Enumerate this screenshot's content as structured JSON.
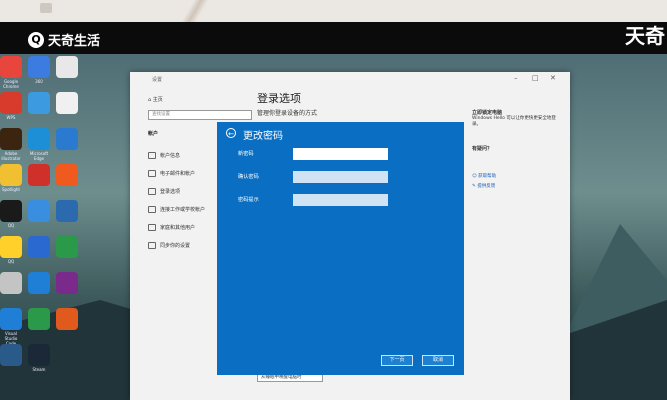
{
  "overlay": {
    "brand_text": "天奇生活",
    "brand_glyph": "Q",
    "brand_right_text": "天奇"
  },
  "desktop_icons": [
    {
      "label": "Google Chrome",
      "color": "#e8453c"
    },
    {
      "label": "360",
      "color": "#3c7be0"
    },
    {
      "label": "",
      "color": "#e8e8e8"
    },
    {
      "label": "WPS",
      "color": "#d83b2b"
    },
    {
      "label": "",
      "color": "#3c9be0"
    },
    {
      "label": "",
      "color": "#f0f0f0"
    },
    {
      "label": "Adobe Illustrator",
      "color": "#3b2410"
    },
    {
      "label": "Microsoft Edge",
      "color": "#1d8fd6"
    },
    {
      "label": "",
      "color": "#2a7ad0"
    },
    {
      "label": "Spotlight",
      "color": "#f0c030"
    },
    {
      "label": "",
      "color": "#d0302a"
    },
    {
      "label": "",
      "color": "#f05a1e"
    },
    {
      "label": "QQ",
      "color": "#1a1a1a"
    },
    {
      "label": "",
      "color": "#3a8ee0"
    },
    {
      "label": "",
      "color": "#2c6ab0"
    },
    {
      "label": "QQ",
      "color": "#ffd02a"
    },
    {
      "label": "",
      "color": "#2a6ad0"
    },
    {
      "label": "",
      "color": "#2a9a4a"
    },
    {
      "label": "",
      "color": "#c4c4c4"
    },
    {
      "label": "",
      "color": "#1f7fd6"
    },
    {
      "label": "",
      "color": "#7a2a8a"
    },
    {
      "label": "Visual Studio Code",
      "color": "#1f7fd6"
    },
    {
      "label": "",
      "color": "#2a9a4a"
    },
    {
      "label": "",
      "color": "#e05a1e"
    },
    {
      "label": "",
      "color": "#2a5a8a"
    },
    {
      "label": "Steam",
      "color": "#1b2838"
    }
  ],
  "settings": {
    "window_title": "设置",
    "home_label": "主页",
    "search_placeholder": "查找设置",
    "category": "帐户",
    "nav_items": [
      "帐户信息",
      "电子邮件和帐户",
      "登录选项",
      "连接工作或学校帐户",
      "家庭和其他用户",
      "同步你的设置"
    ],
    "page_title": "登录选项",
    "page_subtitle": "管理你登录设备的方式",
    "right_heading": "立即锁定电脑",
    "right_text": "Windows Hello 可以让你更快更安全地登录。",
    "right_heading2": "有疑问？",
    "right_link1": "获取帮助",
    "right_link2": "提供反馈",
    "bottom_dropdown": "从睡眠中唤醒电脑时"
  },
  "dialog": {
    "title": "更改密码",
    "fields": [
      {
        "label": "新密码",
        "value": ""
      },
      {
        "label": "确认密码",
        "value": ""
      },
      {
        "label": "密码提示",
        "value": ""
      }
    ],
    "next_button": "下一页",
    "cancel_button": "取消"
  },
  "colors": {
    "dialog_blue": "#0a6fc3",
    "button_blue": "#1e80d0",
    "window_bg": "#f2f2f2"
  }
}
